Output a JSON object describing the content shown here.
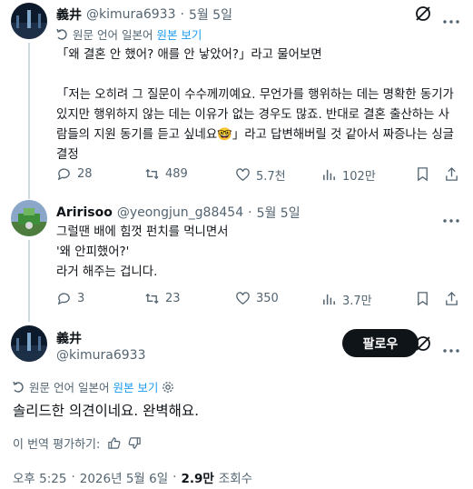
{
  "tweet1": {
    "name": "義井",
    "handle": "@kimura6933",
    "separator": "·",
    "date": "5월 5일",
    "translation_note": "원문 언어 일본어",
    "show_original": "원본 보기",
    "body": "「왜 결혼 안 했어? 애를 안 낳았어?」라고 물어보면\n\n「저는 오히려 그 질문이 수수께끼예요. 무언가를 행위하는 데는 명확한 동기가 있지만 행위하지 않는 데는 이유가 없는 경우도 많죠. 반대로 결혼 출산하는 사람들의 지원 동기를 듣고 싶네요🤓」라고 답변해버릴 것 같아서 짜증나는 싱글 결정",
    "actions": {
      "replies": "28",
      "reposts": "489",
      "likes": "5.7천",
      "views": "102만"
    }
  },
  "tweet2": {
    "name": "Aririsoo",
    "handle": "@yeongjun_g88454",
    "separator": "·",
    "date": "5월 5일",
    "body": "그럴땐 배에 힘껏 펀치를 먹니면서\n'왜 안피했어?'\n라거 해주는 겁니다.",
    "actions": {
      "replies": "3",
      "reposts": "23",
      "likes": "350",
      "views": "3.7만"
    }
  },
  "main": {
    "name": "義井",
    "handle": "@kimura6933",
    "follow_label": "팔로우",
    "translation_note": "원문 언어 일본어",
    "show_original": "원본 보기",
    "body": "솔리드한 의견이네요. 완벽해요.",
    "rate_label": "이 번역 평가하기:",
    "time": "오후 5:25",
    "separator": "·",
    "date": "2026년 5월 6일",
    "views_count": "2.9만",
    "views_label": "조회수"
  },
  "colors": {
    "accent": "#1d9bf0",
    "text": "#0f1419",
    "muted": "#536471",
    "button": "#0f1419"
  }
}
